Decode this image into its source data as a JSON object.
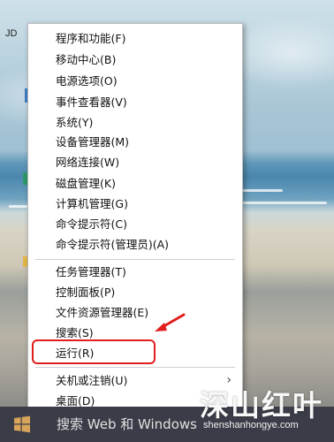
{
  "desktop": {
    "icon_label": "JD"
  },
  "context_menu": {
    "items": [
      "程序和功能(F)",
      "移动中心(B)",
      "电源选项(O)",
      "事件查看器(V)",
      "系统(Y)",
      "设备管理器(M)",
      "网络连接(W)",
      "磁盘管理(K)",
      "计算机管理(G)",
      "命令提示符(C)",
      "命令提示符(管理员)(A)",
      "任务管理器(T)",
      "控制面板(P)",
      "文件资源管理器(E)",
      "搜索(S)",
      "运行(R)",
      "关机或注销(U)",
      "桌面(D)"
    ],
    "highlight_color": "#e11d1d"
  },
  "taskbar": {
    "search_placeholder": "搜索 Web 和 Windows",
    "start_icon": "windows-logo-icon"
  },
  "watermark": {
    "title": "深山红叶",
    "url": "shenshanhongye.com"
  }
}
